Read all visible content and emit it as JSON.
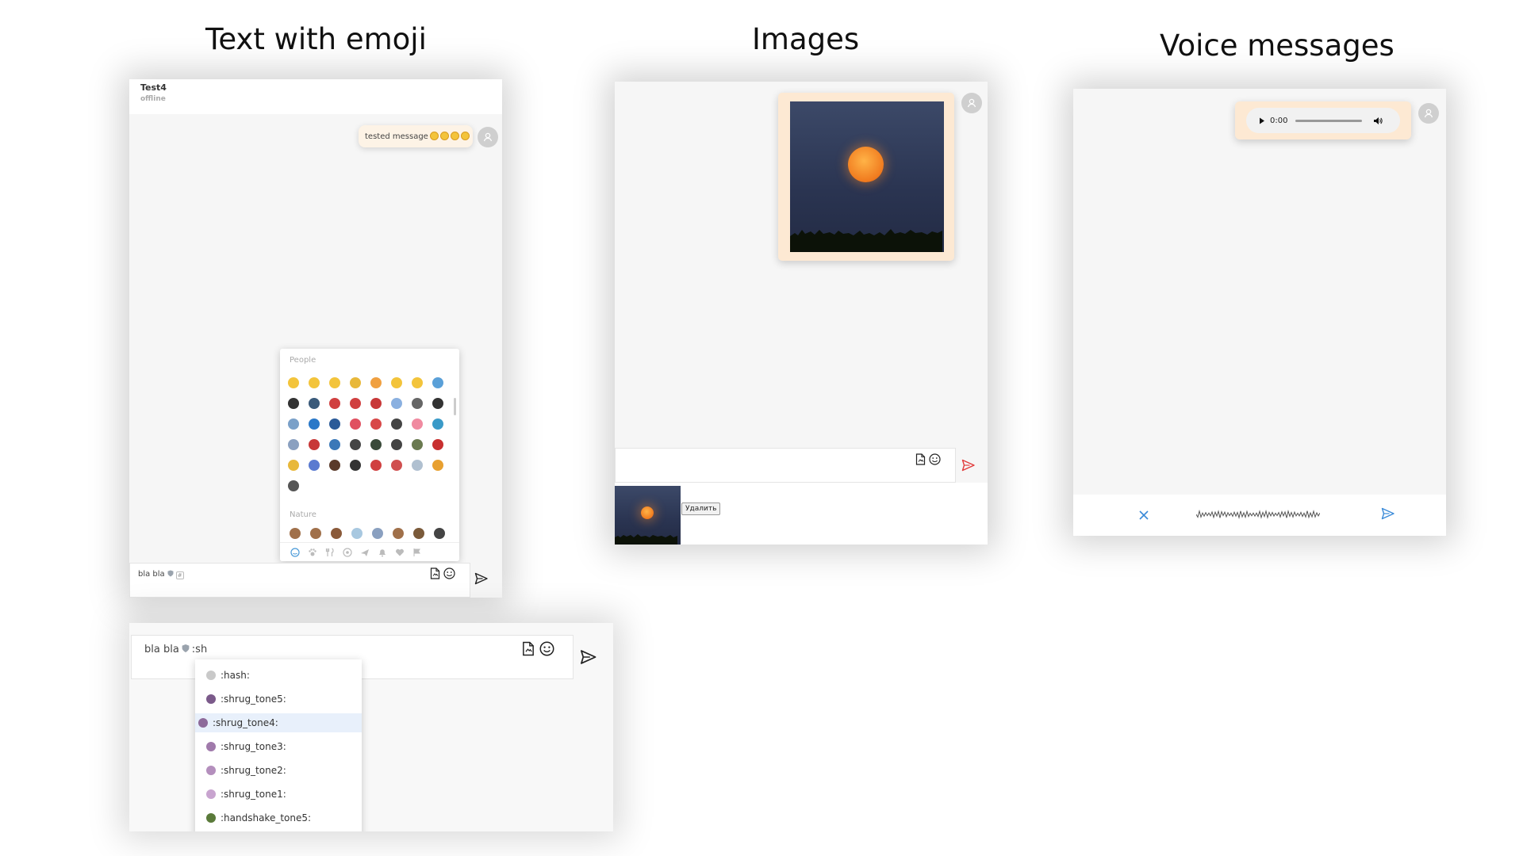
{
  "titles": {
    "emoji": "Text with emoji",
    "images": "Images",
    "voice": "Voice messages"
  },
  "emoji_panel": {
    "contact_name": "Test4",
    "contact_status": "offline",
    "message_text": "tested message",
    "picker": {
      "categories": [
        "People",
        "Nature"
      ],
      "tab_icons": [
        "smiley-icon",
        "paw-icon",
        "fork-knife-icon",
        "soccer-ball-icon",
        "airplane-icon",
        "bell-icon",
        "heart-icon",
        "flag-icon"
      ]
    },
    "input_text": "bla bla"
  },
  "autocomplete_panel": {
    "input_text": "bla bla",
    "query": ":sh",
    "suggestions": [
      {
        "label": ":hash:",
        "color": "#c9c9c9"
      },
      {
        "label": ":shrug_tone5:",
        "color": "#7b5a8a"
      },
      {
        "label": ":shrug_tone4:",
        "color": "#8d6a9a"
      },
      {
        "label": ":shrug_tone3:",
        "color": "#a07aab"
      },
      {
        "label": ":shrug_tone2:",
        "color": "#b48fbd"
      },
      {
        "label": ":shrug_tone1:",
        "color": "#c8a4cf"
      },
      {
        "label": ":handshake_tone5:",
        "color": "#5a7a3a"
      }
    ],
    "selected_index": 2
  },
  "images_panel": {
    "delete_label": "Удалить"
  },
  "voice_panel": {
    "audio_time": "0:00"
  },
  "colors": {
    "bubble": "#fdf3e6",
    "send_active": "#e23b3b",
    "voice_accent": "#3a8ad8",
    "selected_row": "#e8f0fb"
  }
}
